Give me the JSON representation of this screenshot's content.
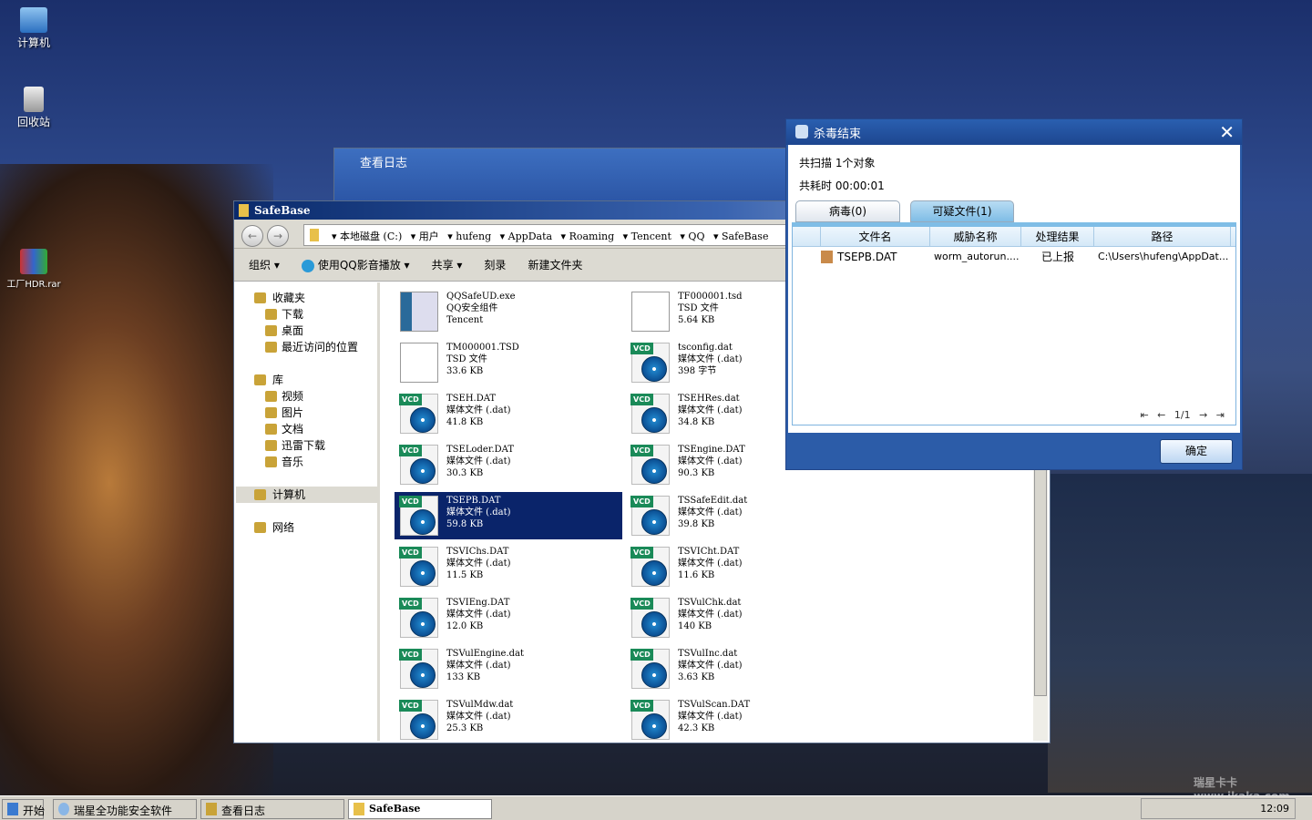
{
  "desktop": {
    "icons": [
      {
        "label": "计算机"
      },
      {
        "label": "回收站"
      },
      {
        "label": "工厂HDR.rar"
      }
    ],
    "watermark": "瑞星卡卡 www.ikaka.com"
  },
  "log_window": {
    "title": "查看日志"
  },
  "explorer": {
    "title": "SafeBase",
    "breadcrumb": [
      "本地磁盘 (C:)",
      "用户",
      "hufeng",
      "AppData",
      "Roaming",
      "Tencent",
      "QQ",
      "SafeBase"
    ],
    "toolbar": {
      "organize": "组织 ▾",
      "play": "使用QQ影音播放 ▾",
      "share": "共享 ▾",
      "burn": "刻录",
      "new_folder": "新建文件夹"
    },
    "nav": [
      {
        "label": "收藏夹",
        "head": true
      },
      {
        "label": "下载"
      },
      {
        "label": "桌面"
      },
      {
        "label": "最近访问的位置"
      },
      {
        "label": "库",
        "head": true
      },
      {
        "label": "视频"
      },
      {
        "label": "图片"
      },
      {
        "label": "文档"
      },
      {
        "label": "迅雷下载"
      },
      {
        "label": "音乐"
      },
      {
        "label": "计算机",
        "head": true
      },
      {
        "label": "网络",
        "head": true
      }
    ],
    "files": [
      {
        "name": "QQSafeUD.exe",
        "type": "QQ安全组件",
        "size": "Tencent",
        "icon": "exe"
      },
      {
        "name": "TF000001.tsd",
        "type": "TSD 文件",
        "size": "5.64 KB",
        "icon": "doc"
      },
      {
        "name": "TM000001.TSD",
        "type": "TSD 文件",
        "size": "33.6 KB",
        "icon": "doc"
      },
      {
        "name": "tsconfig.dat",
        "type": "媒体文件 (.dat)",
        "size": "398 字节",
        "icon": "vcd"
      },
      {
        "name": "TSEH.DAT",
        "type": "媒体文件 (.dat)",
        "size": "41.8 KB",
        "icon": "vcd"
      },
      {
        "name": "TSEHRes.dat",
        "type": "媒体文件 (.dat)",
        "size": "34.8 KB",
        "icon": "vcd"
      },
      {
        "name": "TSELoder.DAT",
        "type": "媒体文件 (.dat)",
        "size": "30.3 KB",
        "icon": "vcd"
      },
      {
        "name": "TSEngine.DAT",
        "type": "媒体文件 (.dat)",
        "size": "90.3 KB",
        "icon": "vcd"
      },
      {
        "name": "TSEPB.DAT",
        "type": "媒体文件 (.dat)",
        "size": "59.8 KB",
        "icon": "vcd",
        "selected": true
      },
      {
        "name": "TSSafeEdit.dat",
        "type": "媒体文件 (.dat)",
        "size": "39.8 KB",
        "icon": "vcd"
      },
      {
        "name": "TSVIChs.DAT",
        "type": "媒体文件 (.dat)",
        "size": "11.5 KB",
        "icon": "vcd"
      },
      {
        "name": "TSVICht.DAT",
        "type": "媒体文件 (.dat)",
        "size": "11.6 KB",
        "icon": "vcd"
      },
      {
        "name": "TSVIEng.DAT",
        "type": "媒体文件 (.dat)",
        "size": "12.0 KB",
        "icon": "vcd"
      },
      {
        "name": "TSVulChk.dat",
        "type": "媒体文件 (.dat)",
        "size": "140 KB",
        "icon": "vcd"
      },
      {
        "name": "TSVulEngine.dat",
        "type": "媒体文件 (.dat)",
        "size": "133 KB",
        "icon": "vcd"
      },
      {
        "name": "TSVulInc.dat",
        "type": "媒体文件 (.dat)",
        "size": "3.63 KB",
        "icon": "vcd"
      },
      {
        "name": "TSVulMdw.dat",
        "type": "媒体文件 (.dat)",
        "size": "25.3 KB",
        "icon": "vcd"
      },
      {
        "name": "TSVulScan.DAT",
        "type": "媒体文件 (.dat)",
        "size": "42.3 KB",
        "icon": "vcd"
      }
    ],
    "vcd_badge": "VCD"
  },
  "dialog": {
    "title": "杀毒结束",
    "scanned": "共扫描  1个对象",
    "elapsed": "共耗时  00:00:01",
    "tabs": [
      "病毒(0)",
      "可疑文件(1)"
    ],
    "columns": [
      "文件名",
      "威胁名称",
      "处理结果",
      "路径"
    ],
    "rows": [
      [
        "TSEPB.DAT",
        "worm_autorun....",
        "已上报",
        "C:\\Users\\hufeng\\AppDat..."
      ]
    ],
    "pager": "⇤ ← 1/1 → ⇥",
    "ok": "确定"
  },
  "taskbar": {
    "start": "开始",
    "items": [
      "瑞星全功能安全软件",
      "查看日志",
      "SafeBase"
    ],
    "clock": "12:09"
  }
}
